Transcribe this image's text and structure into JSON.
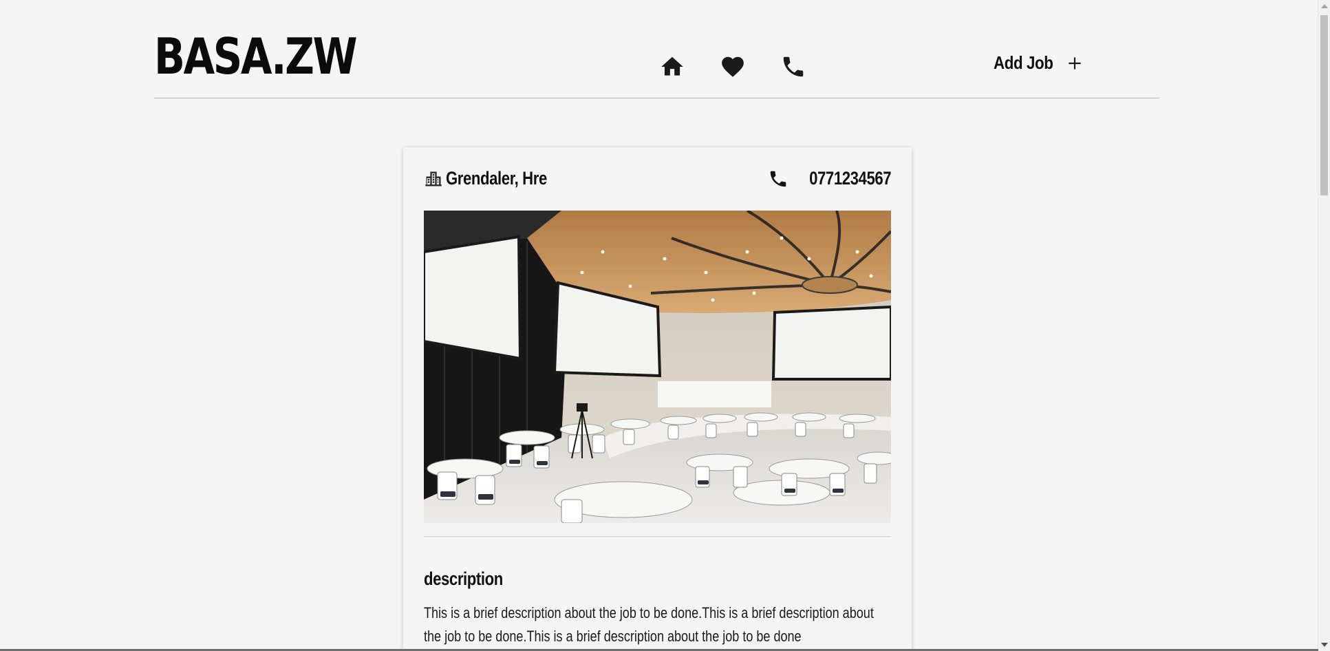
{
  "header": {
    "logo": "BASA.ZW",
    "nav": [
      {
        "name": "home-icon",
        "label": "home"
      },
      {
        "name": "heart-icon",
        "label": "favorites"
      },
      {
        "name": "phone-icon",
        "label": "contact"
      }
    ],
    "add_job_label": "Add Job",
    "add_job_icon": "plus-icon"
  },
  "job_card": {
    "location": "Grendaler, Hre",
    "location_icon": "building-icon",
    "phone": "0771234567",
    "phone_icon": "phone-icon",
    "image_alt": "conference hall with round tables and projection screens",
    "description_title": "description",
    "description_text": "This is a brief description about the job to be done.This is a brief description about the job to be done.This is a brief description about the job to be done"
  },
  "colors": {
    "background": "#f5f5f5",
    "text": "#111111",
    "divider": "#b5b5b5"
  }
}
